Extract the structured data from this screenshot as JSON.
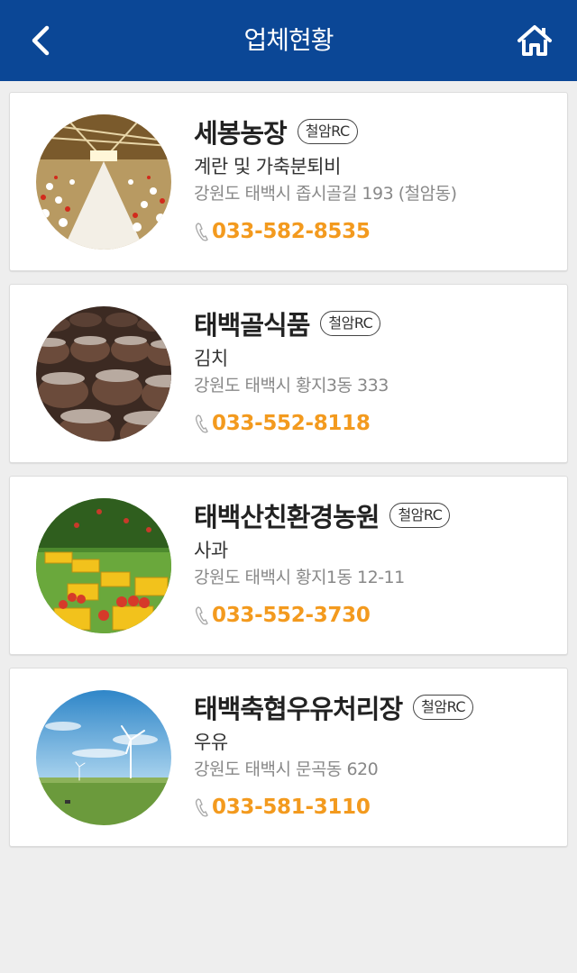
{
  "header": {
    "title": "업체현황",
    "back_icon": "chevron-left-icon",
    "home_icon": "home-icon",
    "background": "#0b4796"
  },
  "accent_color": "#f39a1e",
  "companies": [
    {
      "name": "세봉농장",
      "badge": "철암RC",
      "product": "계란 및 가축분퇴비",
      "address": "강원도 태백시 좁시골길 193 (철암동)",
      "phone": "033-582-8535",
      "image": "chicken-barn-photo"
    },
    {
      "name": "태백골식품",
      "badge": "철암RC",
      "product": "김치",
      "address": "강원도 태백시 황지3동 333",
      "phone": "033-552-8118",
      "image": "kimchi-jars-photo"
    },
    {
      "name": "태백산친환경농원",
      "badge": "철암RC",
      "product": "사과",
      "address": "강원도 태백시 황지1동 12-11",
      "phone": "033-552-3730",
      "image": "apple-orchard-photo"
    },
    {
      "name": "태백축협우유처리장",
      "badge": "철암RC",
      "product": "우유",
      "address": "강원도 태백시 문곡동 620",
      "phone": "033-581-3110",
      "image": "wind-turbine-pasture-photo"
    }
  ]
}
